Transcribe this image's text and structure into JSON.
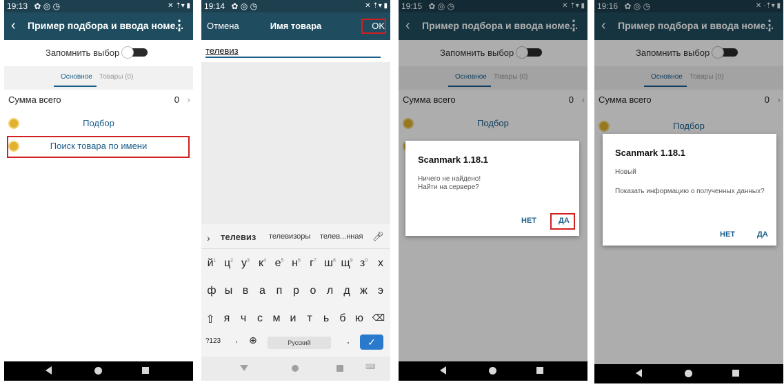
{
  "screens": [
    {
      "status_time": "19:13",
      "status_icons": "✿ ◎ ◷",
      "status_right": "✕ ⇡▾ ▮",
      "title": "Пример подбора и ввода номе...",
      "remember_label": "Запомнить выбор",
      "tabs": [
        "Основное",
        "Товары (0)"
      ],
      "sum_label": "Сумма всего",
      "sum_value": "0",
      "items": [
        "Подбор",
        "Поиск товара по имени"
      ]
    },
    {
      "status_time": "19:14",
      "status_icons": "✿ ◎ ◷",
      "status_right": "✕ ⇡▾ ▮",
      "cancel_label": "Отмена",
      "title": "Имя товара",
      "ok_label": "OK",
      "input_value": "телевиз",
      "suggestions": [
        "телевиз",
        "телевизоры",
        "телев...нная"
      ],
      "row1": [
        "й",
        "ц",
        "у",
        "к",
        "е",
        "н",
        "г",
        "ш",
        "щ",
        "з",
        "х"
      ],
      "row1_digits": [
        "1",
        "2",
        "3",
        "4",
        "5",
        "6",
        "7",
        "8",
        "9",
        "0"
      ],
      "row2": [
        "ф",
        "ы",
        "в",
        "а",
        "п",
        "р",
        "о",
        "л",
        "д",
        "ж",
        "э"
      ],
      "row3": [
        "я",
        "ч",
        "с",
        "м",
        "и",
        "т",
        "ь",
        "б",
        "ю"
      ],
      "symbols_key": "?123",
      "space_label": "Русский",
      "period_key": ".",
      "comma_key": ","
    },
    {
      "status_time": "19:15",
      "status_icons": "✿ ◎ ◷",
      "status_right": "✕ ⇡▾ ▮",
      "title": "Пример подбора и ввода номе...",
      "remember_label": "Запомнить выбор",
      "tabs": [
        "Основное",
        "Товары (0)"
      ],
      "sum_label": "Сумма всего",
      "sum_value": "0",
      "items": [
        "Подбор"
      ],
      "dialog_title": "Scanmark 1.18.1",
      "dialog_lines": [
        "Ничего не найдено!",
        "Найти на сервере?"
      ],
      "btn_no": "НЕТ",
      "btn_yes": "ДА"
    },
    {
      "status_time": "19:16",
      "status_icons": "✿ ◎ ◷",
      "status_right": "✕ ·⇡▾ ▮",
      "title": "Пример подбора и ввода номе...",
      "remember_label": "Запомнить выбор",
      "tabs": [
        "Основное",
        "Товары (0)"
      ],
      "sum_label": "Сумма всего",
      "sum_value": "0",
      "items": [
        "Подбор"
      ],
      "dialog_title": "Scanmark 1.18.1",
      "dialog_status": "Новый",
      "dialog_question": "Показать информацию о полученных данных?",
      "btn_no": "НЕТ",
      "btn_yes": "ДА"
    }
  ],
  "colors": {
    "appbar": "#1f4d5f",
    "statusbar": "#1d3f4e",
    "accent": "#1a5e8a",
    "highlight": "#d21f1f",
    "coin": "#e0b030"
  }
}
